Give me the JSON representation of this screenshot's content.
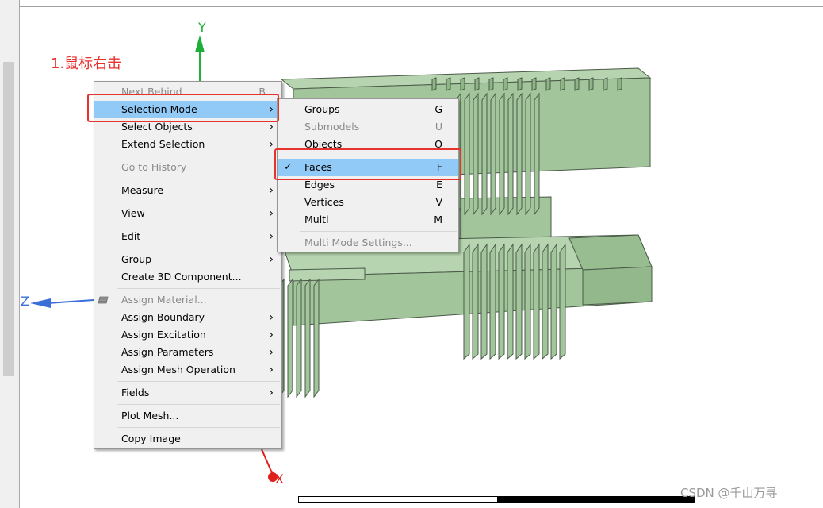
{
  "annotation": "1.鼠标右击",
  "watermark": "CSDN @千山万寻",
  "axes": {
    "y": "Y",
    "z": "Z",
    "x": "X"
  },
  "colors": {
    "model_fill": "#a2c59b",
    "model_stroke": "#4a5a48",
    "highlight": "#91c9f7",
    "annotation": "#e8322d"
  },
  "context_menu": {
    "items": [
      {
        "label": "Next Behind",
        "shortcut": "B",
        "disabled": true
      },
      {
        "label": "Selection Mode",
        "submenu": true,
        "highlight": true
      },
      {
        "label": "Select Objects",
        "submenu": true
      },
      {
        "label": "Extend Selection",
        "submenu": true
      },
      {
        "sep": true
      },
      {
        "label": "Go to History",
        "disabled": true
      },
      {
        "sep": true
      },
      {
        "label": "Measure",
        "submenu": true
      },
      {
        "sep": true
      },
      {
        "label": "View",
        "submenu": true
      },
      {
        "sep": true
      },
      {
        "label": "Edit",
        "submenu": true
      },
      {
        "sep": true
      },
      {
        "label": "Group",
        "submenu": true
      },
      {
        "label": "Create 3D Component..."
      },
      {
        "sep": true
      },
      {
        "label": "Assign Material...",
        "disabled": true,
        "icon": "material-icon"
      },
      {
        "label": "Assign Boundary",
        "submenu": true
      },
      {
        "label": "Assign Excitation",
        "submenu": true
      },
      {
        "label": "Assign Parameters",
        "submenu": true
      },
      {
        "label": "Assign Mesh Operation",
        "submenu": true
      },
      {
        "sep": true
      },
      {
        "label": "Fields",
        "submenu": true
      },
      {
        "sep": true
      },
      {
        "label": "Plot Mesh..."
      },
      {
        "sep": true
      },
      {
        "label": "Copy Image"
      }
    ]
  },
  "submenu": {
    "items": [
      {
        "label": "Groups",
        "shortcut": "G"
      },
      {
        "label": "Submodels",
        "shortcut": "U",
        "disabled": true
      },
      {
        "label": "Objects",
        "shortcut": "O"
      },
      {
        "sep": true
      },
      {
        "label": "Faces",
        "shortcut": "F",
        "checked": true,
        "highlight": true
      },
      {
        "label": "Edges",
        "shortcut": "E"
      },
      {
        "label": "Vertices",
        "shortcut": "V"
      },
      {
        "label": "Multi",
        "shortcut": "M"
      },
      {
        "sep": true
      },
      {
        "label": "Multi Mode Settings...",
        "disabled": true
      }
    ]
  }
}
